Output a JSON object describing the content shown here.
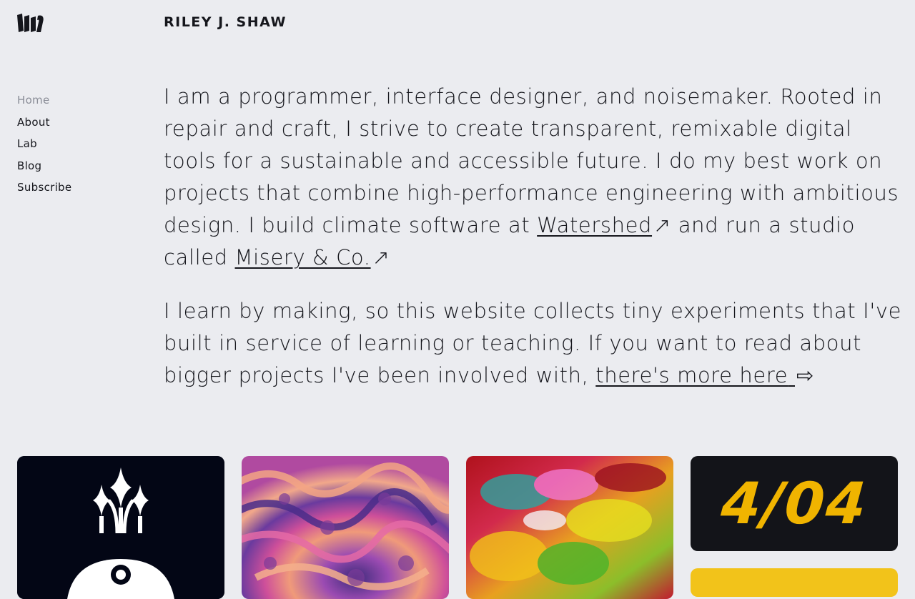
{
  "header": {
    "logo_icon": "rjs-monogram-icon",
    "site_name": "RILEY J. SHAW"
  },
  "nav": {
    "items": [
      {
        "label": "Home",
        "active": true
      },
      {
        "label": "About",
        "active": false
      },
      {
        "label": "Lab",
        "active": false
      },
      {
        "label": "Blog",
        "active": false
      },
      {
        "label": "Subscribe",
        "active": false
      }
    ]
  },
  "intro": {
    "p1_text": "I am a programmer, interface designer, and noisemaker. Rooted in repair and craft, I strive to create transparent, remixable digital tools for a sustainable and accessible future. I do my best work on projects that combine high-performance engineering with ambitious design. I build climate software at ",
    "p1_link1": "Watershed",
    "p1_mid": " and run a studio called ",
    "p1_link2": "Misery & Co.",
    "external_arrow": "↗",
    "p2_text": "I learn by making, so this website collects tiny experiments that I've built in service of learning or teaching. If you want to read about bigger projects I've been involved with, ",
    "p2_link": "there's more here",
    "more_arrow": "⇨"
  },
  "cards": {
    "card_4_text": "4/04"
  },
  "colors": {
    "background": "#ebecf0",
    "text": "#15161c",
    "nav_active": "#8a8d97",
    "card_dark": "#030615",
    "accent_yellow": "#f0b400"
  }
}
